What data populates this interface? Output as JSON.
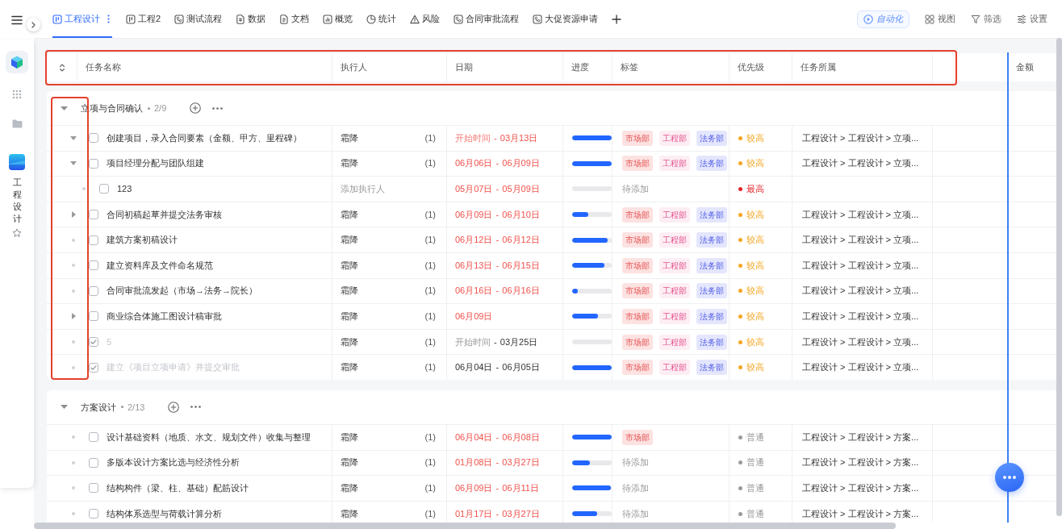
{
  "sidebar": {
    "app_label": "工程设计"
  },
  "tabs": [
    {
      "label": "工程设计",
      "kind": "table",
      "selected": true
    },
    {
      "label": "工程2",
      "kind": "table",
      "selected": false
    },
    {
      "label": "测试流程",
      "kind": "flow",
      "selected": false
    },
    {
      "label": "数据",
      "kind": "sheet",
      "selected": false
    },
    {
      "label": "文档",
      "kind": "doc",
      "selected": false
    },
    {
      "label": "概览",
      "kind": "dashboard",
      "selected": false
    },
    {
      "label": "统计",
      "kind": "stats",
      "selected": false
    },
    {
      "label": "风险",
      "kind": "risk",
      "selected": false
    },
    {
      "label": "合同审批流程",
      "kind": "flow",
      "selected": false
    },
    {
      "label": "大促资源申请",
      "kind": "flow",
      "selected": false
    }
  ],
  "toolbar": {
    "automation": "自动化",
    "actions": [
      {
        "label": "视图",
        "kind": "view"
      },
      {
        "label": "筛选",
        "kind": "filter"
      },
      {
        "label": "设置",
        "kind": "settings"
      }
    ]
  },
  "table": {
    "header_highlighted": true,
    "columns": [
      "任务名称",
      "执行人",
      "日期",
      "进度",
      "标签",
      "优先级",
      "任务所属",
      "金额"
    ]
  },
  "groups": [
    {
      "title": "立项与合同确认",
      "count": "2/9",
      "expanded": true,
      "toggles_highlighted": true,
      "rows": [
        {
          "kind": "branch",
          "expanded": true,
          "checked": false,
          "name": "创建项目，录入合同要素（金额、甲方、里程碑）",
          "assignee": {
            "name": "霜降",
            "count": "(1)"
          },
          "date": {
            "start": "开始时间",
            "start_set": false,
            "separator": "-",
            "end": "03月13日",
            "overdue": true
          },
          "progress": {
            "level": 1
          },
          "tags": [
            {
              "label": "市场部",
              "color": "#fde2e2"
            },
            {
              "label": "工程部",
              "color": "#fdeef4"
            },
            {
              "label": "法务部",
              "color": "#e4e6fd"
            }
          ],
          "priority": {
            "label": "较高",
            "color": "#f5a623"
          },
          "path": "工程设计 > 工程设计 > 立项..."
        },
        {
          "kind": "branch",
          "expanded": true,
          "checked": false,
          "name": "项目经理分配与团队组建",
          "assignee": {
            "name": "霜降",
            "count": "(1)"
          },
          "date": {
            "start": "06月06日",
            "start_set": true,
            "separator": "-",
            "end": "06月09日",
            "overdue": true
          },
          "progress": {
            "level": 1
          },
          "tags": [
            {
              "label": "市场部",
              "color": "#fde2e2"
            },
            {
              "label": "工程部",
              "color": "#fdeef4"
            },
            {
              "label": "法务部",
              "color": "#e4e6fd"
            }
          ],
          "priority": {
            "label": "较高",
            "color": "#f5a623"
          },
          "path": "工程设计 > 工程设计 > 立项...",
          "children": [
            {
              "kind": "leaf",
              "checked": false,
              "name": "123",
              "assignee": {
                "placeholder": "添加执行人"
              },
              "date": {
                "start": "05月07日",
                "start_set": true,
                "separator": "-",
                "end": "05月09日",
                "overdue": true
              },
              "progress": {
                "level": 0
              },
              "tags_placeholder": "待添加",
              "priority": {
                "label": "最高",
                "color": "#e8242b"
              }
            }
          ]
        },
        {
          "kind": "branch",
          "expanded": false,
          "checked": false,
          "name": "合同初稿起草并提交法务审核",
          "assignee": {
            "name": "霜降",
            "count": "(1)"
          },
          "date": {
            "start": "06月09日",
            "start_set": true,
            "separator": "-",
            "end": "06月10日",
            "overdue": true
          },
          "progress": {
            "level": 0.41
          },
          "tags": [
            {
              "label": "市场部",
              "color": "#fde2e2"
            },
            {
              "label": "工程部",
              "color": "#fdeef4"
            },
            {
              "label": "法务部",
              "color": "#e4e6fd"
            }
          ],
          "priority": {
            "label": "较高",
            "color": "#f5a623"
          },
          "path": "工程设计 > 工程设计 > 立项..."
        },
        {
          "kind": "leaf",
          "checked": false,
          "name": "建筑方案初稿设计",
          "assignee": {
            "name": "霜降",
            "count": "(1)"
          },
          "date": {
            "start": "06月12日",
            "start_set": true,
            "separator": "-",
            "end": "06月12日",
            "overdue": true
          },
          "progress": {
            "level": 0.9
          },
          "tags": [
            {
              "label": "市场部",
              "color": "#fde2e2"
            },
            {
              "label": "工程部",
              "color": "#fdeef4"
            },
            {
              "label": "法务部",
              "color": "#e4e6fd"
            }
          ],
          "priority": {
            "label": "较高",
            "color": "#f5a623"
          },
          "path": "工程设计 > 工程设计 > 立项..."
        },
        {
          "kind": "leaf",
          "checked": false,
          "name": "建立资料库及文件命名规范",
          "assignee": {
            "name": "霜降",
            "count": "(1)"
          },
          "date": {
            "start": "06月13日",
            "start_set": true,
            "separator": "-",
            "end": "06月15日",
            "overdue": true
          },
          "progress": {
            "level": 0.82
          },
          "tags": [
            {
              "label": "市场部",
              "color": "#fde2e2"
            },
            {
              "label": "工程部",
              "color": "#fdeef4"
            },
            {
              "label": "法务部",
              "color": "#e4e6fd"
            }
          ],
          "priority": {
            "label": "较高",
            "color": "#f5a623"
          },
          "path": "工程设计 > 工程设计 > 立项..."
        },
        {
          "kind": "leaf",
          "checked": false,
          "name": "合同审批流发起（市场→法务→院长）",
          "assignee": {
            "name": "霜降",
            "count": "(1)"
          },
          "date": {
            "start": "06月16日",
            "start_set": true,
            "separator": "-",
            "end": "06月16日",
            "overdue": true
          },
          "progress": {
            "level": 0.15
          },
          "tags": [
            {
              "label": "市场部",
              "color": "#fde2e2"
            },
            {
              "label": "工程部",
              "color": "#fdeef4"
            },
            {
              "label": "法务部",
              "color": "#e4e6fd"
            }
          ],
          "priority": {
            "label": "较高",
            "color": "#f5a623"
          },
          "path": "工程设计 > 工程设计 > 立项..."
        },
        {
          "kind": "branch",
          "expanded": false,
          "checked": false,
          "name": "商业综合体施工图设计稿审批",
          "assignee": {
            "name": "霜降",
            "count": "(1)"
          },
          "date": {
            "start": "06月09日",
            "start_set": true,
            "overdue": true
          },
          "progress": {
            "level": 0.66
          },
          "tags": [
            {
              "label": "市场部",
              "color": "#fde2e2"
            },
            {
              "label": "工程部",
              "color": "#fdeef4"
            },
            {
              "label": "法务部",
              "color": "#e4e6fd"
            }
          ],
          "priority": {
            "label": "较高",
            "color": "#f5a623"
          },
          "path": "工程设计 > 工程设计 > 立项..."
        },
        {
          "kind": "leaf",
          "checked": true,
          "name": "5",
          "assignee": {
            "name": "霜降",
            "count": "(1)"
          },
          "date": {
            "start": "开始时间",
            "start_set": false,
            "separator": "-",
            "end": "03月25日",
            "overdue": false
          },
          "progress": {
            "level": 0
          },
          "tags": [
            {
              "label": "市场部",
              "color": "#fde2e2"
            },
            {
              "label": "工程部",
              "color": "#fdeef4"
            },
            {
              "label": "法务部",
              "color": "#e4e6fd"
            }
          ],
          "priority": {
            "label": "较高",
            "color": "#f5a623"
          },
          "path": "工程设计 > 工程设计 > 立项..."
        },
        {
          "kind": "leaf",
          "checked": true,
          "name": "建立《项目立项申请》并提交审批",
          "assignee": {
            "name": "霜降",
            "count": "(1)"
          },
          "date": {
            "start": "06月04日",
            "start_set": true,
            "separator": "-",
            "end": "06月05日",
            "overdue": false
          },
          "progress": {
            "level": 1
          },
          "tags": [
            {
              "label": "市场部",
              "color": "#fde2e2"
            },
            {
              "label": "工程部",
              "color": "#fdeef4"
            },
            {
              "label": "法务部",
              "color": "#e4e6fd"
            }
          ],
          "priority": {
            "label": "较高",
            "color": "#f5a623"
          },
          "path": "工程设计 > 工程设计 > 立项..."
        }
      ]
    },
    {
      "title": "方案设计",
      "count": "2/13",
      "expanded": true,
      "toggles_highlighted": false,
      "rows": [
        {
          "kind": "leaf",
          "checked": false,
          "name": "设计基础资料（地质、水文、规划文件）收集与整理",
          "assignee": {
            "name": "霜降",
            "count": "(1)"
          },
          "date": {
            "start": "06月04日",
            "start_set": true,
            "separator": "-",
            "end": "06月08日",
            "overdue": true
          },
          "progress": {
            "level": 1
          },
          "tags": [
            {
              "label": "市场部",
              "color": "#fde2e2"
            }
          ],
          "priority": {
            "label": "普通",
            "color": "#9b9b9b"
          },
          "path": "工程设计 > 工程设计 > 方案..."
        },
        {
          "kind": "leaf",
          "checked": false,
          "name": "多版本设计方案比选与经济性分析",
          "assignee": {
            "name": "霜降",
            "count": "(1)"
          },
          "date": {
            "start": "01月08日",
            "start_set": true,
            "separator": "-",
            "end": "03月27日",
            "overdue": true
          },
          "progress": {
            "level": 0.45
          },
          "tags_placeholder": "待添加",
          "priority": {
            "label": "普通",
            "color": "#9b9b9b"
          },
          "path": "工程设计 > 工程设计 > 方案..."
        },
        {
          "kind": "leaf",
          "checked": false,
          "name": "结构构件（梁、柱、基础）配筋设计",
          "assignee": {
            "name": "霜降",
            "count": "(1)"
          },
          "date": {
            "start": "06月09日",
            "start_set": true,
            "separator": "-",
            "end": "06月11日",
            "overdue": true
          },
          "progress": {
            "level": 0.98
          },
          "tags_placeholder": "待添加",
          "priority": {
            "label": "普通",
            "color": "#9b9b9b"
          },
          "path": "工程设计 > 工程设计 > 方案..."
        },
        {
          "kind": "leaf",
          "checked": false,
          "name": "结构体系选型与荷载计算分析",
          "assignee": {
            "name": "霜降",
            "count": "(1)"
          },
          "date": {
            "start": "01月17日",
            "start_set": true,
            "separator": "-",
            "end": "03月27日",
            "overdue": true
          },
          "progress": {
            "level": 0.63
          },
          "tags_placeholder": "待添加",
          "priority": {
            "label": "普通",
            "color": "#9b9b9b"
          },
          "path": "工程设计 > 工程设计 > 方案..."
        }
      ]
    }
  ]
}
